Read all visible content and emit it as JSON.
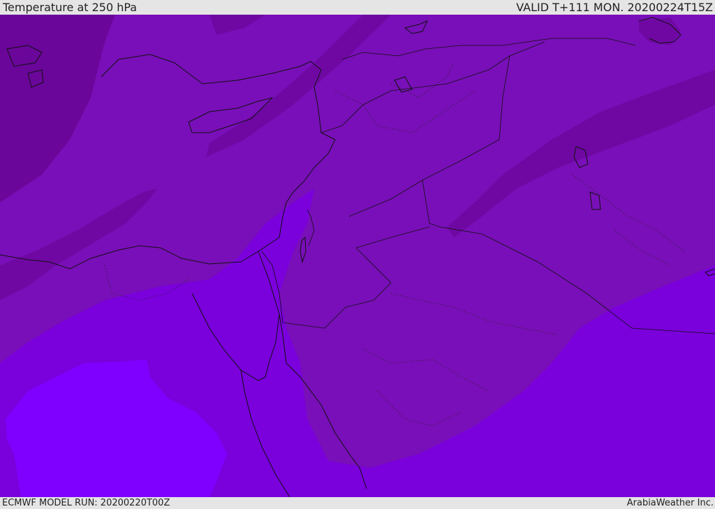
{
  "header": {
    "title": "Temperature at 250 hPa",
    "valid": "VALID T+111 MON. 20200224T15Z"
  },
  "footer": {
    "model_run": "ECMWF MODEL RUN: 20200220T00Z",
    "credit": "ArabiaWeather Inc."
  },
  "map": {
    "field": "Temperature at 250 hPa",
    "colors": {
      "band_darkest": "#6a0699",
      "band_dark": "#7410ad",
      "band_main": "#790fb8",
      "band_warm": "#7a00dc",
      "band_warmest": "#7f00ff",
      "coastline": "#111111"
    }
  }
}
